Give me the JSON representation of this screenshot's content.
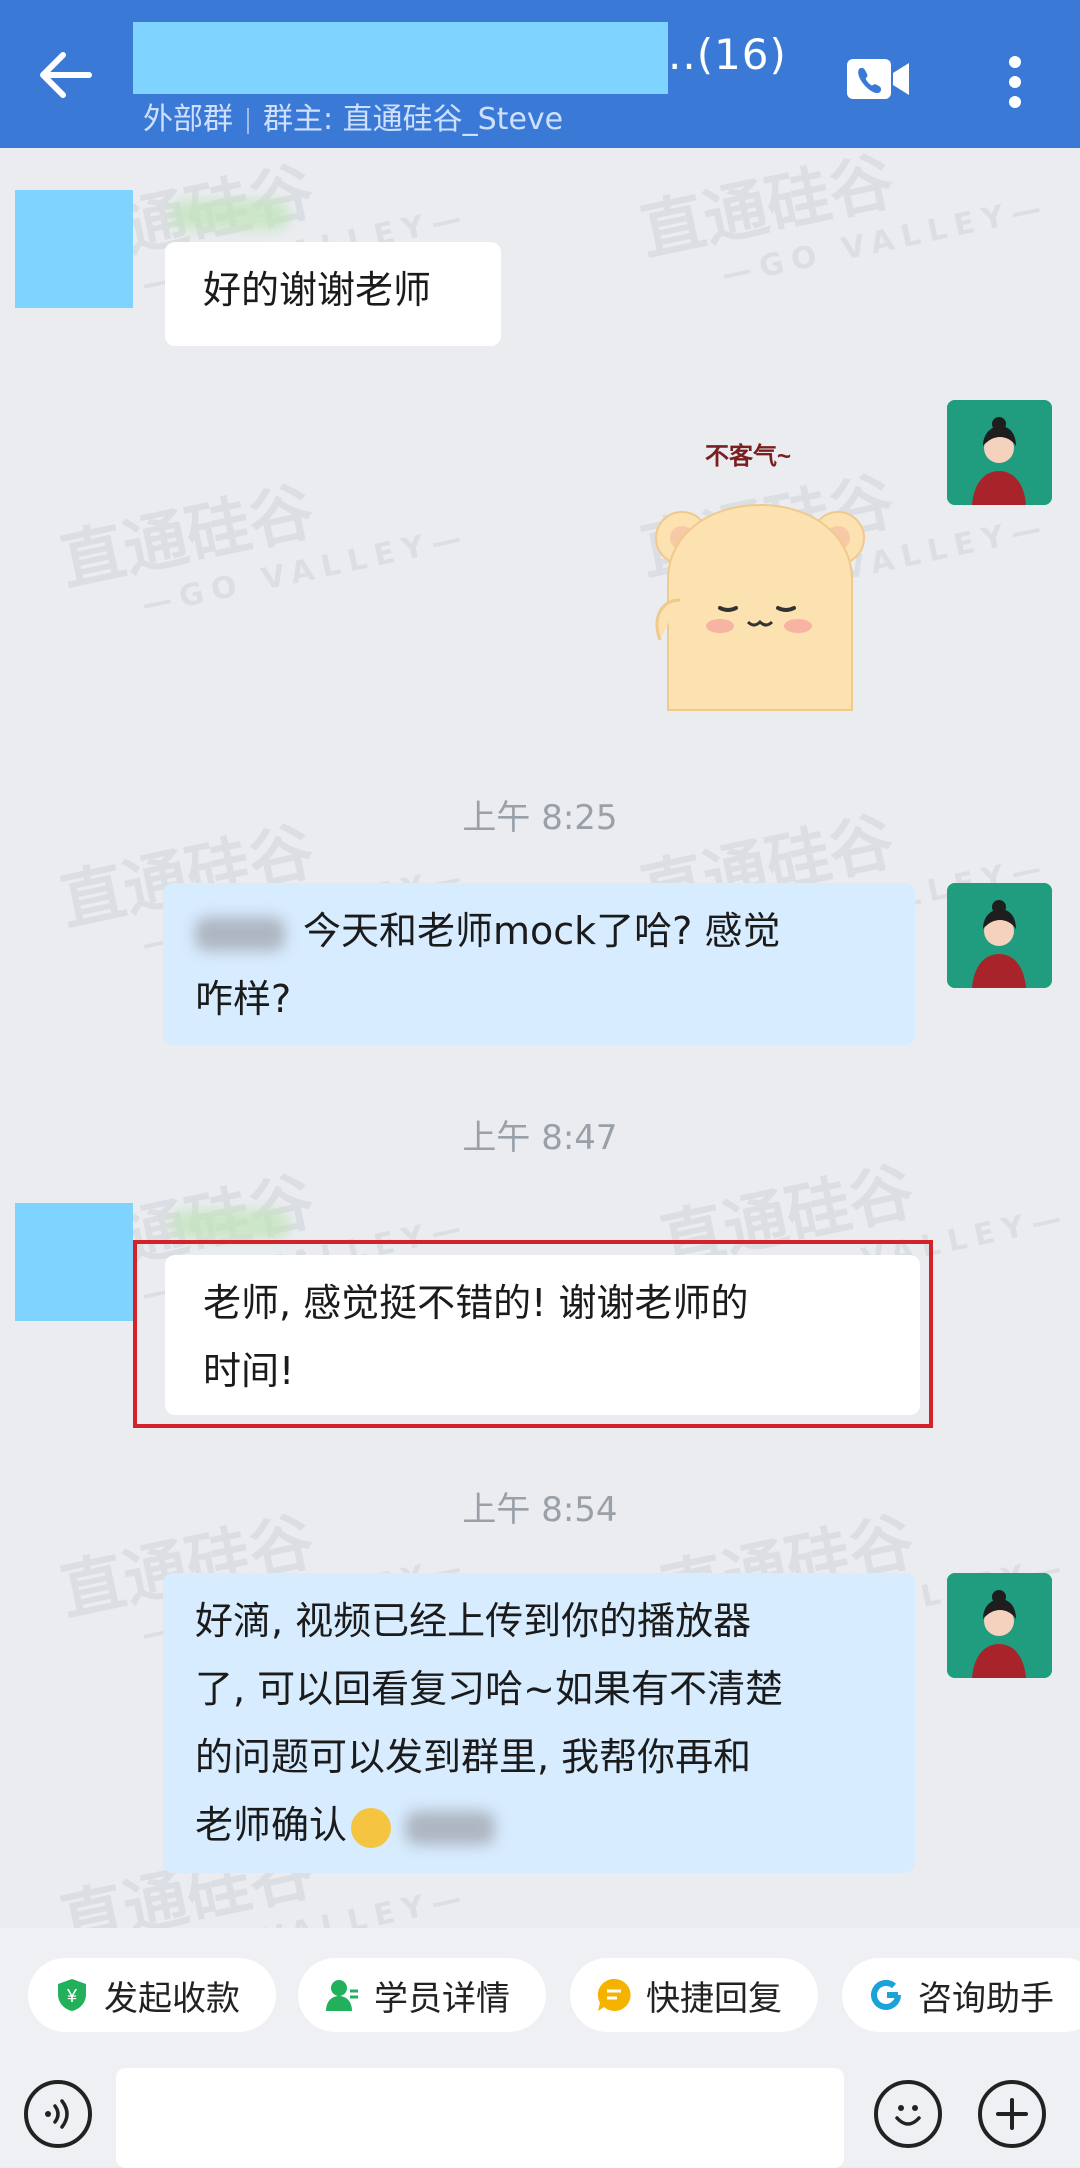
{
  "header": {
    "title_suffix": "..(16)",
    "group_type": "外部群",
    "owner": "群主: 直通硅谷_Steve"
  },
  "watermark": {
    "text": "直通硅谷",
    "sub": "—GO VALLEY—"
  },
  "messages": {
    "m1": {
      "text": "好的谢谢老师"
    },
    "sticker": {
      "caption": "不客气~"
    },
    "t1": "上午 8:25",
    "m2": {
      "line1": "今天和老师mock了哈? 感觉",
      "line2": "咋样?"
    },
    "t2": "上午 8:47",
    "m3": {
      "line1": "老师, 感觉挺不错的! 谢谢老师的",
      "line2": "时间!"
    },
    "t3": "上午 8:54",
    "m4": {
      "line1": "好滴, 视频已经上传到你的播放器",
      "line2": "了, 可以回看复习哈~如果有不清楚",
      "line3": "的问题可以发到群里, 我帮你再和",
      "line4": "老师确认"
    }
  },
  "quick_actions": [
    {
      "label": "发起收款",
      "icon": "payment-icon"
    },
    {
      "label": "学员详情",
      "icon": "student-icon"
    },
    {
      "label": "快捷回复",
      "icon": "quick-reply-icon"
    },
    {
      "label": "咨询助手",
      "icon": "assistant-icon"
    }
  ],
  "colors": {
    "header": "#3a7ad6",
    "bubble_self": "#d7ecfe",
    "highlight": "#d3222a",
    "mask": "#7fd4ff"
  }
}
